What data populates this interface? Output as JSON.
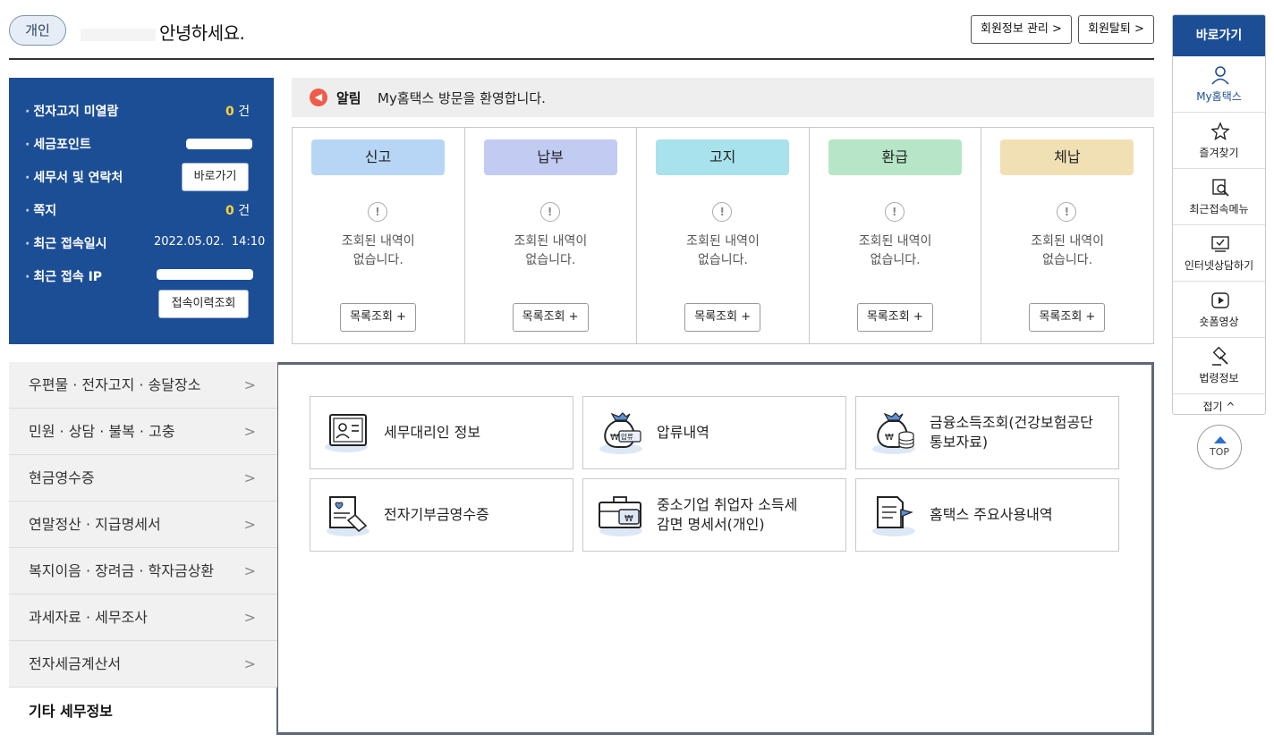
{
  "header": {
    "badge": "개인",
    "greeting": "안녕하세요.",
    "member_btn": "회원정보 관리 >",
    "withdraw_btn": "회원탈퇴 >"
  },
  "info": {
    "rows": [
      {
        "label": "전자고지 미열람",
        "value": "0",
        "unit": "건"
      },
      {
        "label": "세금포인트"
      },
      {
        "label": "세무서 및 연락처",
        "button": "바로가기"
      },
      {
        "label": "쪽지",
        "value": "0",
        "unit": "건"
      },
      {
        "label": "최근 접속일시",
        "value": "2022.05.02.  14:10"
      },
      {
        "label": "최근 접속 IP"
      }
    ],
    "history_btn": "접속이력조회"
  },
  "notice": {
    "icon": "speaker-icon",
    "label": "알림",
    "text": "My홈택스 방문을 환영합니다."
  },
  "status": {
    "columns": [
      {
        "title": "신고",
        "color": "#b7d6f6",
        "msg": "조회된 내역이\n없습니다.",
        "btn": "목록조회 +"
      },
      {
        "title": "납부",
        "color": "#c2cbf2",
        "msg": "조회된 내역이\n없습니다.",
        "btn": "목록조회 +"
      },
      {
        "title": "고지",
        "color": "#a8e2ec",
        "msg": "조회된 내역이\n없습니다.",
        "btn": "목록조회 +"
      },
      {
        "title": "환급",
        "color": "#b6e6c7",
        "msg": "조회된 내역이\n없습니다.",
        "btn": "목록조회 +"
      },
      {
        "title": "체납",
        "color": "#f1e0b3",
        "msg": "조회된 내역이\n없습니다.",
        "btn": "목록조회 +"
      }
    ]
  },
  "menu": {
    "items": [
      "우편물 · 전자고지 · 송달장소",
      "민원 · 상담 · 불복 · 고충",
      "현금영수증",
      "연말정산 · 지급명세서",
      "복지이음 · 장려금 · 학자금상환",
      "과세자료 · 세무조사",
      "전자세금계산서"
    ],
    "active": "기타 세무정보"
  },
  "cards": [
    {
      "label": "세무대리인 정보",
      "icon": "id-card-icon"
    },
    {
      "label": "압류내역",
      "icon": "money-bag-seizure-icon",
      "icon_text": "압류"
    },
    {
      "label": "금융소득조회(건강보험공단\n통보자료)",
      "icon": "money-bag-coins-icon"
    },
    {
      "label": "전자기부금영수증",
      "icon": "donation-receipt-icon"
    },
    {
      "label": "중소기업 취업자 소득세\n감면 명세서(개인)",
      "icon": "briefcase-won-icon"
    },
    {
      "label": "홈택스 주요사용내역",
      "icon": "document-flag-icon"
    }
  ],
  "quicknav": {
    "title": "바로가기",
    "items": [
      {
        "label": "My홈택스",
        "icon": "person-icon"
      },
      {
        "label": "즐겨찾기",
        "icon": "star-icon"
      },
      {
        "label": "최근접속메뉴",
        "icon": "recent-search-icon"
      },
      {
        "label": "인터넷상담하기",
        "icon": "monitor-check-icon"
      },
      {
        "label": "숏폼영상",
        "icon": "play-icon"
      },
      {
        "label": "법령정보",
        "icon": "gavel-icon"
      }
    ],
    "fold": "접기 ^",
    "top": "TOP"
  }
}
